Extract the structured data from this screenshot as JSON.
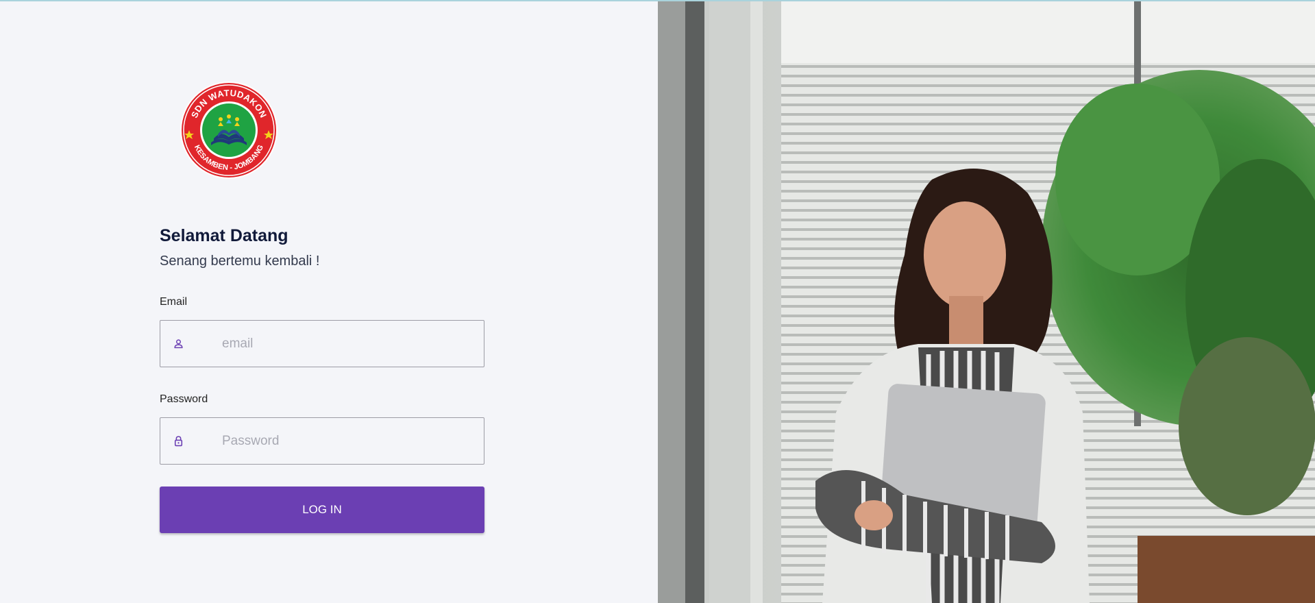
{
  "school_logo": {
    "top_text": "SDN WATUDAKON",
    "bottom_text": "KESAMBEN - JOMBANG",
    "colors": {
      "outer": "#e0262b",
      "inner": "#1fa343",
      "book": "#1f3a7a",
      "stars": "#f4d31b"
    }
  },
  "greeting": {
    "title": "Selamat Datang",
    "subtitle": "Senang bertemu kembali !"
  },
  "form": {
    "email_label": "Email",
    "email_placeholder": "email",
    "email_icon": "user-icon",
    "password_label": "Password",
    "password_placeholder": "Password",
    "password_icon": "lock-icon",
    "login_label": "LOG IN"
  },
  "colors": {
    "accent": "#6b3fb3",
    "background": "#f4f5f9"
  }
}
